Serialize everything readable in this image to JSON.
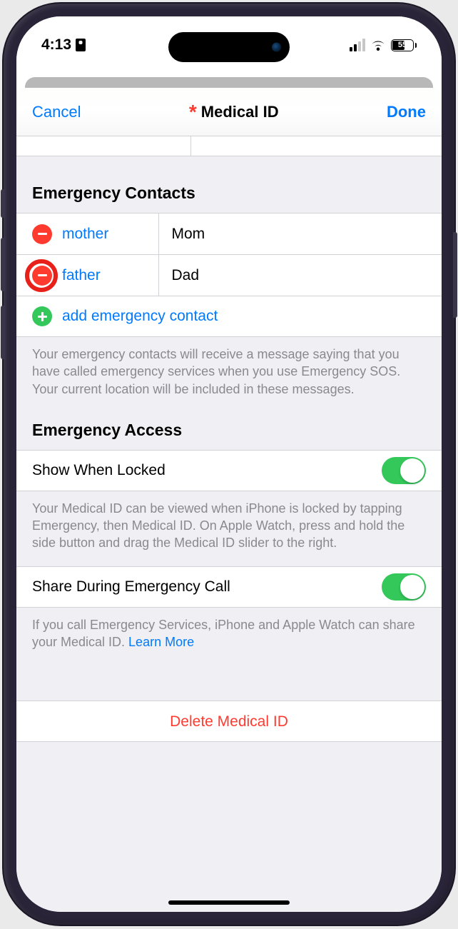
{
  "status": {
    "time": "4:13",
    "battery": "55"
  },
  "nav": {
    "cancel": "Cancel",
    "title": "Medical ID",
    "done": "Done"
  },
  "sections": {
    "contacts_header": "Emergency Contacts",
    "access_header": "Emergency Access"
  },
  "contacts": [
    {
      "relation": "mother",
      "name": "Mom"
    },
    {
      "relation": "father",
      "name": "Dad"
    }
  ],
  "add_contact_label": "add emergency contact",
  "footers": {
    "contacts": "Your emergency contacts will receive a message saying that you have called emergency services when you use Emergency SOS. Your current location will be included in these messages.",
    "show_when_locked": "Your Medical ID can be viewed when iPhone is locked by tapping Emergency, then Medical ID. On Apple Watch, press and hold the side button and drag the Medical ID slider to the right.",
    "share_during_call": "If you call Emergency Services, iPhone and Apple Watch can share your Medical ID. ",
    "learn_more": "Learn More"
  },
  "toggles": {
    "show_when_locked": "Show When Locked",
    "share_during_call": "Share During Emergency Call"
  },
  "delete_label": "Delete Medical ID"
}
